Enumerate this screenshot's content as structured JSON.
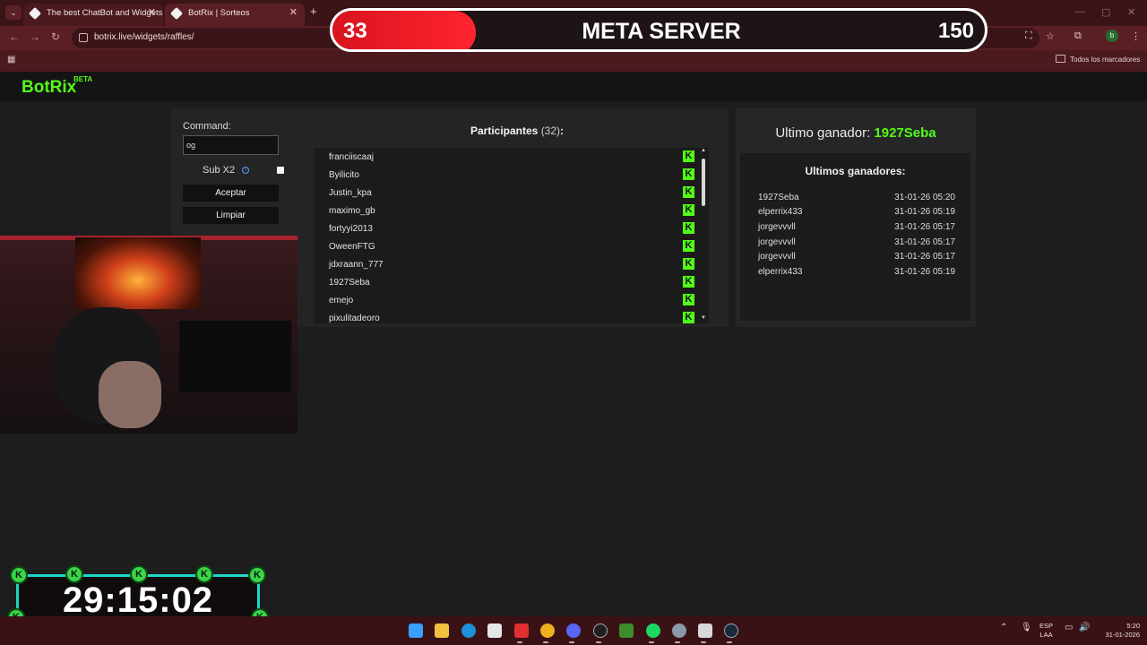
{
  "browser": {
    "tabs": [
      {
        "title": "The best ChatBot and Widgets"
      },
      {
        "title": "BotRix | Sorteos"
      }
    ],
    "url": "botrix.live/widgets/raffles/",
    "bookmarks_label": "Todos los marcadores",
    "profile_initial": "b"
  },
  "brand": {
    "name": "BotRix",
    "badge": "BETA"
  },
  "raffle": {
    "command_label": "Command:",
    "command_value": "og",
    "sub_label": "Sub X2",
    "accept_label": "Aceptar",
    "clear_label": "Limpiar",
    "participants_label": "Participantes",
    "participants_count": "(32)",
    "participants_colon": ":",
    "participants": [
      "franciiscaaj",
      "Byilicito",
      "Justin_kpa",
      "maximo_gb",
      "fortyyi2013",
      "OweenFTG",
      "jdxraann_777",
      "1927Seba",
      "emejo",
      "pixulitadeoro"
    ]
  },
  "winners": {
    "last_label": "Ultimo ganador:",
    "last_name": "1927Seba",
    "title": "Ultimos ganadores:",
    "rows": [
      {
        "name": "1927Seba",
        "date": "31-01-26 05:20"
      },
      {
        "name": "elperrix433",
        "date": "31-01-26 05:19"
      },
      {
        "name": "jorgevvvll",
        "date": "31-01-26 05:17"
      },
      {
        "name": "jorgevvvll",
        "date": "31-01-26 05:17"
      },
      {
        "name": "jorgevvvll",
        "date": "31-01-26 05:17"
      },
      {
        "name": "elperrix433",
        "date": "31-01-26 05:19"
      }
    ]
  },
  "meta_overlay": {
    "current": "33",
    "title": "META SERVER",
    "goal": "150",
    "progress": 0.22
  },
  "timer_overlay": {
    "time": "29:15:02"
  },
  "taskbar": {
    "lang_top": "ESP",
    "lang_bottom": "LAA",
    "time": "5:20",
    "date": "31-01-2026"
  },
  "colors": {
    "kick_green": "#53fc18",
    "accent_red": "#ff2430",
    "chrome": "#5a1f24"
  }
}
